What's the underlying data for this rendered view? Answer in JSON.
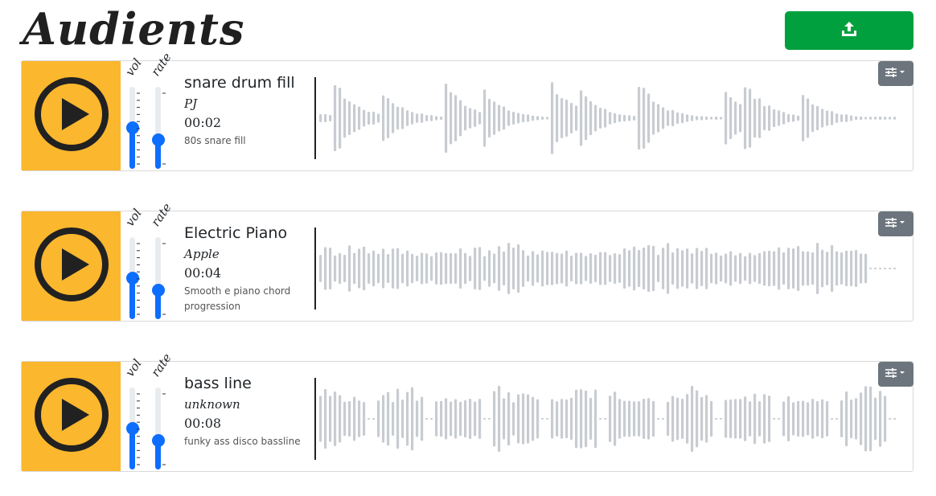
{
  "app": {
    "title": "Audients"
  },
  "header": {
    "upload_icon": "upload-icon"
  },
  "colors": {
    "play_bg": "#fbb72d",
    "upload_bg": "#00a03e",
    "settings_bg": "#6c757d",
    "slider": "#0d6efd",
    "wave": "#c8ccd1"
  },
  "slider_labels": {
    "vol": "vol",
    "rate": "rate"
  },
  "tracks": [
    {
      "title": "snare drum fill",
      "author": "PJ",
      "duration": "00:02",
      "description": "80s snare fill",
      "volume": 0.5,
      "rate": 0.35
    },
    {
      "title": "Electric Piano",
      "author": "Apple",
      "duration": "00:04",
      "description": "Smooth e piano chord progression",
      "volume": 0.5,
      "rate": 0.35
    },
    {
      "title": "bass line",
      "author": "unknown",
      "duration": "00:08",
      "description": "funky ass disco bassline",
      "volume": 0.5,
      "rate": 0.35
    }
  ]
}
